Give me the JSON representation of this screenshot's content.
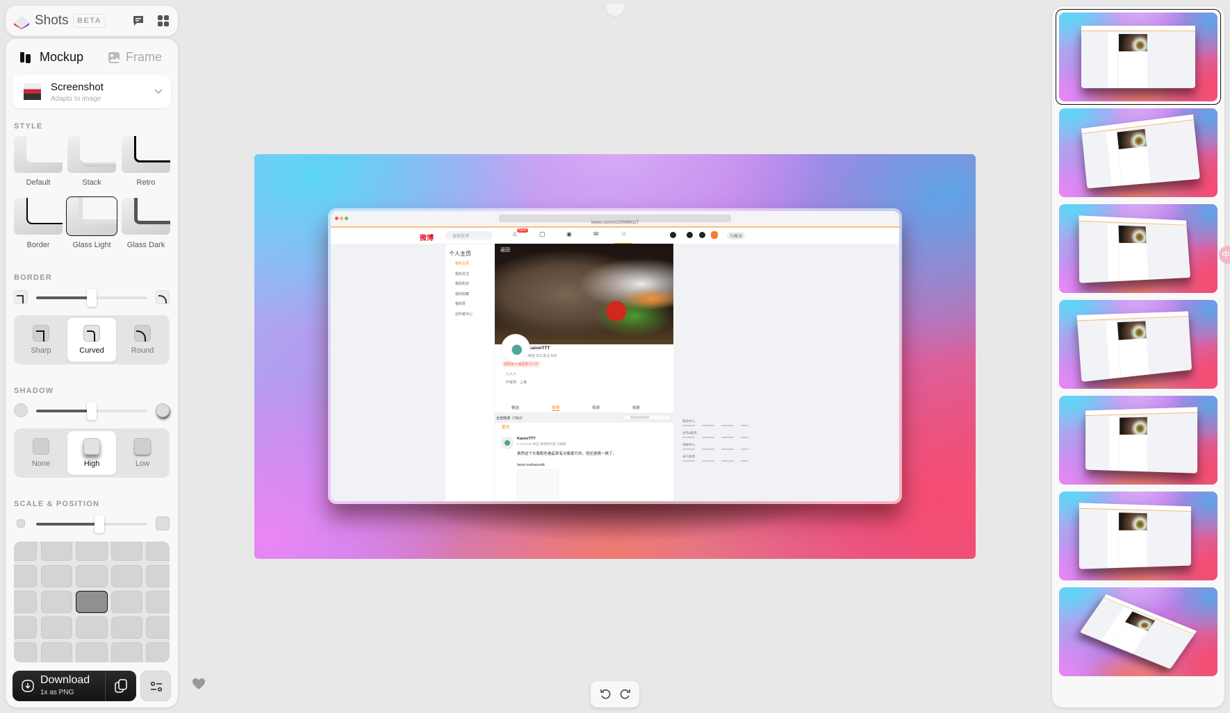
{
  "app": {
    "name": "Shots",
    "badge": "BETA",
    "icons": [
      "chat-icon",
      "apps-grid-icon"
    ]
  },
  "tabs": [
    {
      "label": "Mockup",
      "active": true,
      "icon": "device-icon"
    },
    {
      "label": "Frame",
      "active": false,
      "icon": "image-icon"
    }
  ],
  "device": {
    "title": "Screenshot",
    "subtitle": "Adapts to image"
  },
  "style": {
    "label": "STYLE",
    "options": [
      "Default",
      "Stack",
      "Retro",
      "Border",
      "Glass Light",
      "Glass Dark"
    ],
    "selected": "Glass Light"
  },
  "border": {
    "label": "BORDER",
    "slider_percent": 50,
    "options": [
      "Sharp",
      "Curved",
      "Round"
    ],
    "selected": "Curved"
  },
  "shadow": {
    "label": "SHADOW",
    "slider_percent": 50,
    "options": [
      "None",
      "High",
      "Low"
    ],
    "selected": "High"
  },
  "scale": {
    "label": "SCALE & POSITION",
    "slider_percent": 56,
    "grid_selected": {
      "row": 3,
      "col": 3
    }
  },
  "download": {
    "label": "Download",
    "sublabel": "1x as PNG",
    "icons": [
      "download-icon",
      "copy-icon",
      "settings-sliders-icon"
    ]
  },
  "colors": {
    "accent_orange": "#ff8200",
    "dark_button": "#1c1c1c",
    "panel": "#f8f8f8"
  },
  "mockup": {
    "url": "weibo.com/u/2100889127",
    "nav_badge": "NEW",
    "nav_user": "凡瞰诗",
    "search_placeholder": "搜索微博",
    "back": "返回",
    "sidebar_title": "个人主页",
    "sidebar_items": [
      "我的主页",
      "我的关注",
      "我的粉丝",
      "我的收藏",
      "我的赞",
      "创作者中心"
    ],
    "user_name": "KazooTTT",
    "stats": "粉丝 513   关注 524",
    "badge": "视频累计播放量14.2万",
    "bio": "入入入",
    "ip": "IP属地：上海",
    "profile_tabs": [
      "精选",
      "微博",
      "视频",
      "相册"
    ],
    "all_posts": "全部微博（7662）",
    "post_search": "搜索我的微博",
    "pinned": "置顶",
    "post_time": "5-13 21:56 来自 微博网页版 已编辑",
    "post_text": "虽然这个头像配色看起来有点像麦片的，但还是换一换了。",
    "post_link": "bento.me/kazoottt",
    "footer": [
      "帮助中心",
      "合作&服务",
      "举报中心",
      "关于微博"
    ]
  },
  "history": {
    "icons": [
      "undo-icon",
      "redo-icon"
    ]
  },
  "favorite": {
    "icon": "heart-icon"
  },
  "variants": {
    "count": 7,
    "selected": 1
  }
}
